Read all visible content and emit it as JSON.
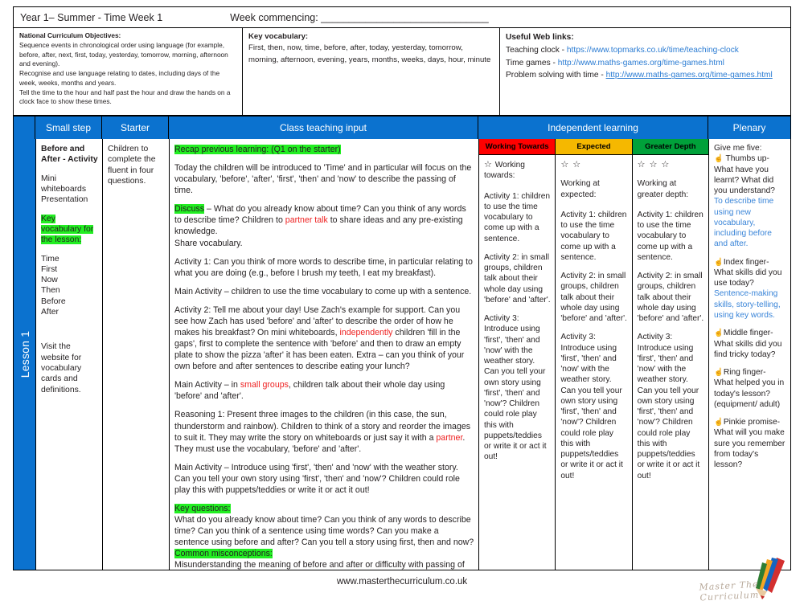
{
  "header": {
    "year_term": "Year 1– Summer - Time Week 1",
    "week_commencing": "Week commencing: ______________________________"
  },
  "info": {
    "nc_heading": "National Curriculum Objectives:",
    "nc_text": "Sequence events in chronological order using language (for example, before, after, next, first, today, yesterday, tomorrow, morning, afternoon and evening).\nRecognise and use language relating to dates, including days of the week, weeks, months and years.\nTell the time to the hour and half past the hour and draw the hands on a clock face to show these times.",
    "vocab_heading": "Key vocabulary:",
    "vocab_text": "First, then, now, time, before, after, today, yesterday, tomorrow, morning, afternoon, evening, years, months, weeks, days, hour, minute",
    "links_heading": "Useful Web links:",
    "link1_label": "Teaching clock - ",
    "link1_url": "https://www.topmarks.co.uk/time/teaching-clock",
    "link2_label": "Time games - ",
    "link2_url": "http://www.maths-games.org/time-games.html",
    "link3_label": "Problem solving with time - ",
    "link3_url": "http://www.maths-games.org/time-games.html"
  },
  "table_headers": {
    "small_step": "Small step",
    "starter": "Starter",
    "class_teaching": "Class teaching input",
    "independent": "Independent learning",
    "plenary": "Plenary"
  },
  "lesson_label": "Lesson 1",
  "small_step": {
    "title": "Before and After - Activity",
    "resources": "Mini whiteboards\nPresentation",
    "key_vocab_heading": "Key vocabulary for the lesson:",
    "vocab_list": "Time\nFirst\nNow\nThen\nBefore\nAfter",
    "website_note": "Visit the website for vocabulary cards and definitions."
  },
  "starter": {
    "text": "Children to complete the fluent in four questions."
  },
  "class_teaching": {
    "recap_heading": "Recap previous learning: (Q1 on the starter)",
    "intro": "Today the children will be introduced to 'Time' and in particular will focus on the vocabulary, 'before', 'after', 'first', 'then' and 'now' to describe the passing of time.",
    "discuss_label": "Discuss",
    "discuss_part1": " – What do you already know about time? Can you think of any words to describe time? Children to ",
    "discuss_highlight": "partner talk",
    "discuss_part2": " to share ideas and any pre-existing knowledge.",
    "share_vocab": "Share vocabulary.",
    "activity1": "Activity 1: Can you think of more words to describe time, in particular relating to what you are doing (e.g., before I brush my teeth, I eat my breakfast).",
    "main_activity1": "Main Activity – children to use the time vocabulary to come up with a sentence.",
    "activity2_part1": "Activity 2: Tell me about your day! Use Zach's example for support. Can you see how Zach has used 'before' and 'after' to describe the order of how he makes his breakfast? On mini whiteboards, ",
    "activity2_highlight": "independently",
    "activity2_part2": " children 'fill in the gaps', first to complete the sentence with 'before' and then to draw an empty plate to show the pizza 'after' it has been eaten. Extra – can you think of your own before and after sentences to describe eating your lunch?",
    "main_activity2_part1": "Main Activity – in ",
    "main_activity2_highlight": "small groups",
    "main_activity2_part2": ", children talk about their whole day using 'before' and 'after'.",
    "reasoning_part1": "Reasoning 1: Present three images to the children (in this case, the sun, thunderstorm and rainbow). Children to think of a story and reorder the images to suit it. They may write the story on whiteboards or just say it with a ",
    "reasoning_highlight": "partner",
    "reasoning_part2": ". They must use the vocabulary, 'before' and 'after'.",
    "main_activity3": "Main Activity – Introduce using 'first', 'then' and 'now' with the weather story. Can you tell your own story using 'first', 'then' and 'now'? Children could role play this with puppets/teddies or write it or act it out!",
    "key_questions_heading": "Key questions:",
    "key_questions": "What do you already know about time? Can you think of any words to describe time? Can you think of a sentence using time words? Can you make a sentence using before and after? Can you tell a story using first, then and now?",
    "misconceptions_heading": "Common misconceptions:",
    "misconceptions": "Misunderstanding the meaning of before and after or difficulty with passing of time."
  },
  "bands": {
    "working_towards": "Working Towards",
    "expected": "Expected",
    "greater_depth": "Greater Depth"
  },
  "differentiation": [
    {
      "stars": "☆",
      "level_label": "Working towards:",
      "activity1": "Activity 1: children to use the time vocabulary to come up with a sentence.",
      "activity2": "Activity 2: in small groups, children talk about their whole day using 'before' and 'after'.",
      "activity3": "Activity 3: Introduce using 'first', 'then' and 'now' with the weather story. Can you tell your own story using 'first', 'then' and 'now'? Children could role play this with puppets/teddies or write it or act it out!"
    },
    {
      "stars": "☆ ☆",
      "level_label": "Working at expected:",
      "activity1": "Activity 1: children to use the time vocabulary to come up with a sentence.",
      "activity2": "Activity 2: in small groups, children talk about their whole day using 'before' and 'after'.",
      "activity3": "Activity 3: Introduce using 'first', 'then' and 'now' with the weather story. Can you tell your own story using 'first', 'then' and 'now'? Children could role play this with puppets/teddies or write it or act it out!"
    },
    {
      "stars": "☆ ☆ ☆",
      "level_label": "Working at greater depth:",
      "activity1": "Activity 1: children to use the time vocabulary to come up with a sentence.",
      "activity2": "Activity 2: in small groups, children talk about their whole day using 'before' and 'after'.",
      "activity3": "Activity 3: Introduce using 'first', 'then' and 'now' with the weather story. Can you tell your own story using 'first', 'then' and 'now'? Children could role play this with puppets/teddies or write it or act it out!"
    }
  ],
  "plenary": {
    "heading": "Give me five:",
    "q1_prompt": "Thumbs up- What have you learnt? What did you understand?",
    "q1_answer": "To describe time using new vocabulary, including before and after.",
    "q2_prompt": "Index finger- What skills did you use today?",
    "q2_answer": "Sentence-making skills, story-telling, using key words.",
    "q3_prompt": "Middle finger- What skills did you find tricky today?",
    "q4_prompt": "Ring finger- What helped you in today's lesson? (equipment/ adult)",
    "q5_prompt": "Pinkie promise- What will you make sure you remember from today's lesson?"
  },
  "footer": {
    "website": "www.masterthecurriculum.co.uk",
    "brand": "Master The Curriculum"
  }
}
